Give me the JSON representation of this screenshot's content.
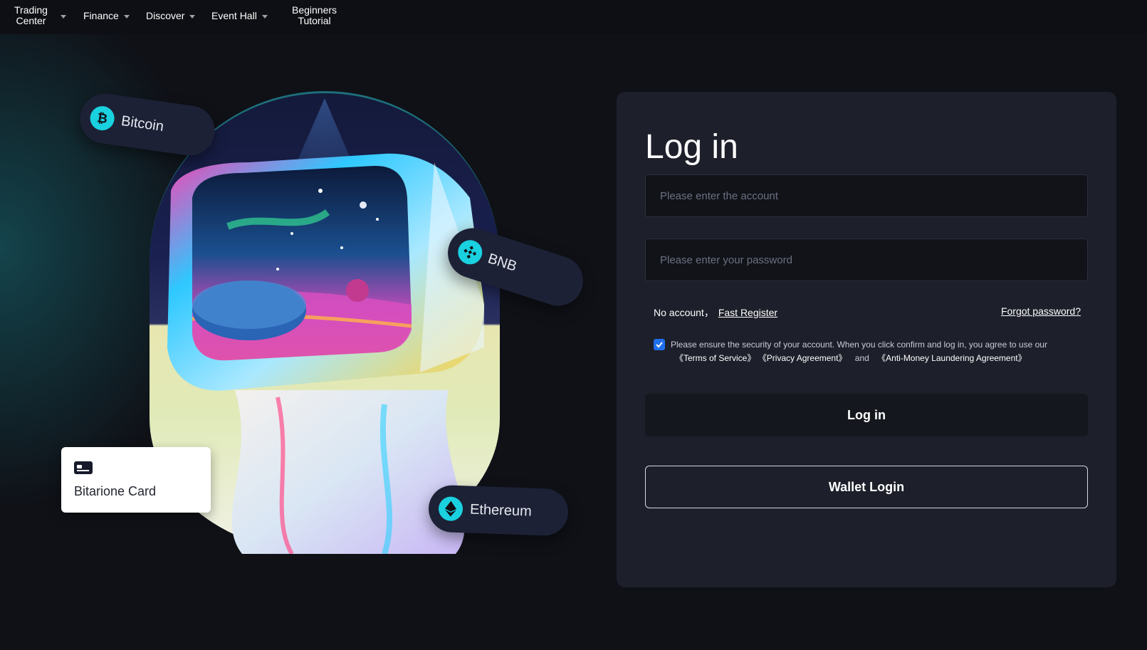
{
  "nav": {
    "trading_center_line1": "Trading",
    "trading_center_line2": "Center",
    "finance": "Finance",
    "discover": "Discover",
    "event_hall": "Event Hall",
    "beginners_line1": "Beginners",
    "beginners_line2": "Tutorial"
  },
  "hero": {
    "bitcoin": "Bitcoin",
    "bitcoin_symbol": "₿",
    "bnb": "BNB",
    "ethereum": "Ethereum",
    "card_label": "Bitarione Card"
  },
  "login": {
    "title": "Log in",
    "account_placeholder": "Please enter the account",
    "password_placeholder": "Please enter your password",
    "no_account": "No account，",
    "fast_register": "Fast Register",
    "forgot_password": "Forgot password?",
    "agree_text": "Please ensure the security of your account. When you click confirm and log in, you agree to use our",
    "terms": "《Terms of Service》",
    "privacy": "《Privacy Agreement》",
    "and": "and",
    "aml": "《Anti-Money Laundering Agreement》",
    "login_button": "Log in",
    "wallet_button": "Wallet Login"
  },
  "colors": {
    "background": "#0f1117",
    "panel": "#1d1f2a",
    "accent_cyan": "#1ad1e0",
    "checkbox": "#1f6feb"
  }
}
